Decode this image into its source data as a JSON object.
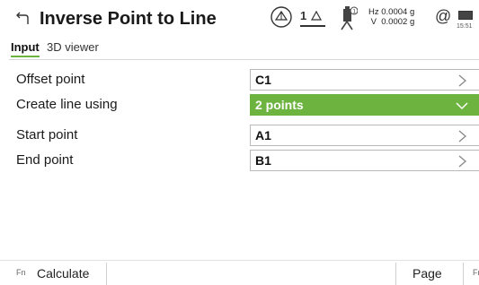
{
  "header": {
    "title": "Inverse Point to Line",
    "status": {
      "target_label": "1",
      "angles_text": "Hz 0.0004 g\n V  0.0002 g",
      "at_symbol": "@",
      "time": "15:51"
    }
  },
  "tabs": [
    {
      "label": "Input",
      "active": true
    },
    {
      "label": "3D viewer",
      "active": false
    }
  ],
  "form": [
    {
      "label": "Offset point",
      "value": "C1",
      "control": "chevron-right"
    },
    {
      "label": "Create line using",
      "value": "2 points",
      "control": "chevron-down",
      "selected": true
    },
    {
      "label": "Start point",
      "value": "A1",
      "control": "chevron-right"
    },
    {
      "label": "End point",
      "value": "B1",
      "control": "chevron-right"
    }
  ],
  "footer": {
    "fn_left": "Fn",
    "calculate": "Calculate",
    "page": "Page",
    "fn_right": "Fn"
  },
  "colors": {
    "accent": "#6cb33f",
    "field_border": "#b9b9b9",
    "text": "#1a1a1a"
  }
}
